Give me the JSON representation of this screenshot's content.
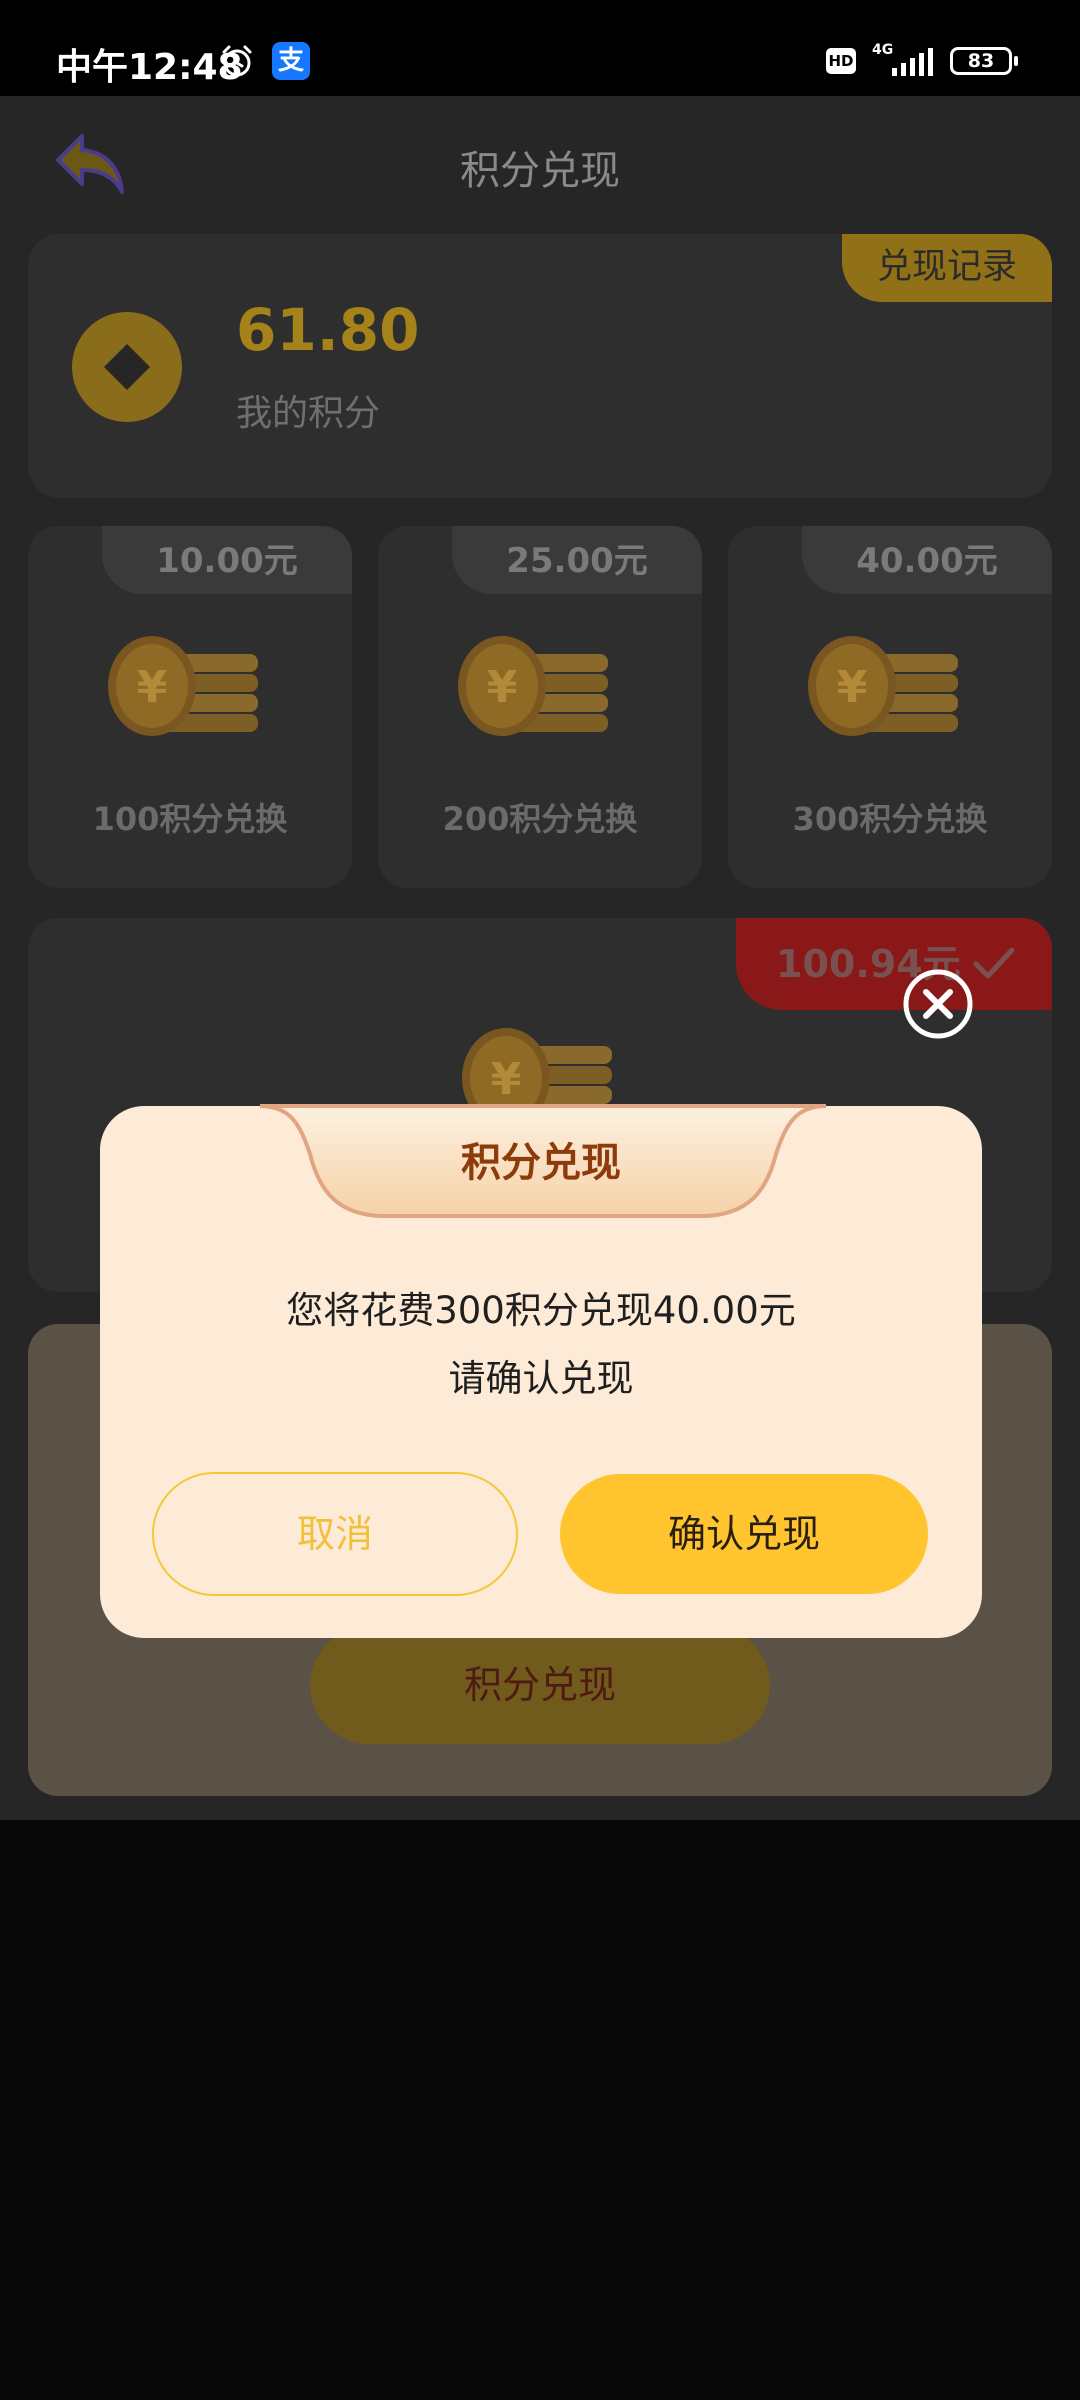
{
  "status_bar": {
    "time": "中午12:48",
    "alipay_glyph": "支",
    "hd_badge": "HD",
    "network": "4G",
    "battery": "83"
  },
  "header": {
    "title": "积分兑现",
    "back_icon": "back-arrow-icon"
  },
  "points": {
    "value": "61.80",
    "label": "我的积分",
    "record_tab": "兑现记录"
  },
  "options": [
    {
      "amount": "10.00元",
      "label": "100积分兑换"
    },
    {
      "amount": "25.00元",
      "label": "200积分兑换"
    },
    {
      "amount": "40.00元",
      "label": "300积分兑换"
    }
  ],
  "featured_option": {
    "amount": "100.94元",
    "selected": true
  },
  "lower_panel": {
    "button_label": "积分兑现"
  },
  "modal": {
    "title": "积分兑现",
    "message_line1": "您将花费300积分兑现40.00元",
    "message_line2": "请确认兑现",
    "cancel_label": "取消",
    "confirm_label": "确认兑现"
  },
  "colors": {
    "accent_yellow": "#ffc42e",
    "modal_bg": "#fdebd7",
    "title_brown": "#8e3b0c",
    "selected_red": "#8a1818"
  }
}
